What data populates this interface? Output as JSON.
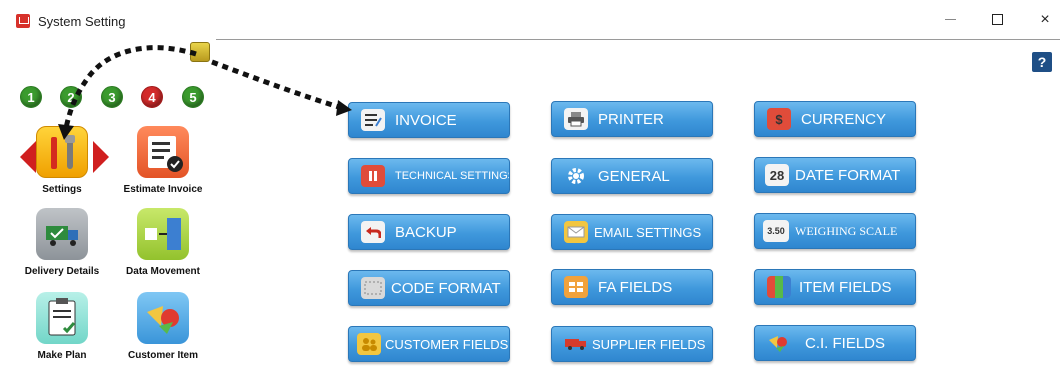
{
  "window": {
    "title": "System Setting",
    "minimize_label": "",
    "maximize_label": "",
    "close_label": "×"
  },
  "help": {
    "label": "?"
  },
  "steps": [
    "1",
    "2",
    "3",
    "4",
    "5"
  ],
  "sidebar": {
    "tiles": [
      {
        "label": "Settings",
        "icon": "wrench-screwdriver-icon"
      },
      {
        "label": "Estimate Invoice",
        "icon": "estimate-invoice-icon"
      },
      {
        "label": "Delivery Details",
        "icon": "delivery-truck-icon"
      },
      {
        "label": "Data Movement",
        "icon": "data-movement-icon"
      },
      {
        "label": "Make Plan",
        "icon": "clipboard-icon"
      },
      {
        "label": "Customer Item",
        "icon": "shapes-icon"
      }
    ]
  },
  "buttons": [
    {
      "label": "INVOICE",
      "icon": "invoice-icon"
    },
    {
      "label": "PRINTER",
      "icon": "printer-icon"
    },
    {
      "label": "CURRENCY",
      "icon": "currency-icon"
    },
    {
      "label": "TECHNICAL SETTINGS",
      "icon": "technical-icon"
    },
    {
      "label": "GENERAL",
      "icon": "gear-icon"
    },
    {
      "label": "DATE FORMAT",
      "icon": "calendar-icon",
      "icon_text": "28"
    },
    {
      "label": "BACKUP",
      "icon": "undo-icon"
    },
    {
      "label": "EMAIL SETTINGS",
      "icon": "email-icon"
    },
    {
      "label": "WEIGHING SCALE",
      "icon": "scale-icon",
      "icon_text": "3.50"
    },
    {
      "label": "CODE FORMAT",
      "icon": "code-format-icon"
    },
    {
      "label": "FA FIELDS",
      "icon": "fa-fields-icon"
    },
    {
      "label": "ITEM FIELDS",
      "icon": "item-fields-icon"
    },
    {
      "label": "CUSTOMER FIELDS",
      "icon": "customer-icon"
    },
    {
      "label": "SUPPLIER FIELDS",
      "icon": "supplier-truck-icon"
    },
    {
      "label": "C.I. FIELDS",
      "icon": "ci-fields-icon"
    }
  ]
}
